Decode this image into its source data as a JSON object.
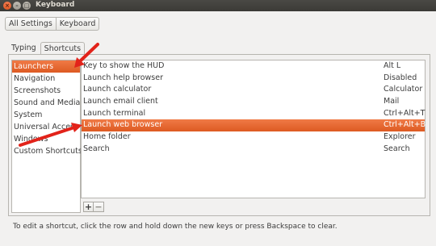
{
  "window": {
    "title": "Keyboard",
    "close_glyph": "×",
    "min_glyph": "–",
    "max_glyph": "□"
  },
  "breadcrumb": {
    "all_settings": "All Settings",
    "current": "Keyboard"
  },
  "tabs": {
    "typing": "Typing",
    "shortcuts": "Shortcuts",
    "active": "shortcuts"
  },
  "categories": [
    {
      "label": "Launchers",
      "selected": true
    },
    {
      "label": "Navigation"
    },
    {
      "label": "Screenshots"
    },
    {
      "label": "Sound and Media"
    },
    {
      "label": "System"
    },
    {
      "label": "Universal Access"
    },
    {
      "label": "Windows"
    },
    {
      "label": "Custom Shortcuts"
    }
  ],
  "shortcuts": [
    {
      "action": "Key to show the HUD",
      "accel": "Alt L"
    },
    {
      "action": "Launch help browser",
      "accel": "Disabled"
    },
    {
      "action": "Launch calculator",
      "accel": "Calculator"
    },
    {
      "action": "Launch email client",
      "accel": "Mail"
    },
    {
      "action": "Launch terminal",
      "accel": "Ctrl+Alt+T"
    },
    {
      "action": "Launch web browser",
      "accel": "Ctrl+Alt+B",
      "selected": true
    },
    {
      "action": "Home folder",
      "accel": "Explorer"
    },
    {
      "action": "Search",
      "accel": "Search"
    }
  ],
  "buttons": {
    "add": "+",
    "remove": "−"
  },
  "footer": {
    "hint": "To edit a shortcut, click the row and hold down the new keys or press Backspace to clear."
  },
  "colors": {
    "selection": "#e8662d",
    "annotation_arrow": "#e2231a",
    "titlebar": "#3c3b37"
  }
}
